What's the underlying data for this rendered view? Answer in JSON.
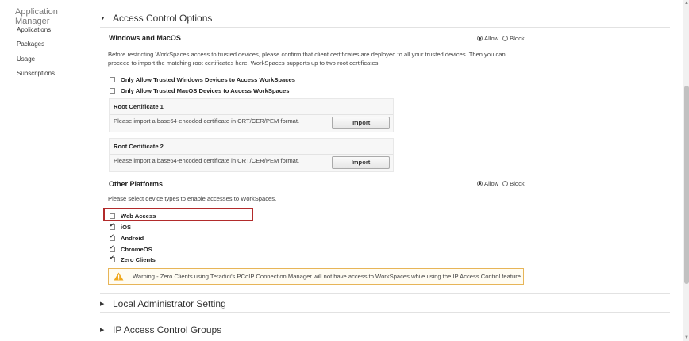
{
  "sidebar": {
    "title": "Application Manager",
    "items": [
      {
        "label": "Applications"
      },
      {
        "label": "Packages"
      },
      {
        "label": "Usage"
      },
      {
        "label": "Subscriptions"
      }
    ]
  },
  "access_control": {
    "title": "Access Control Options",
    "windows_macos": {
      "title": "Windows and MacOS",
      "allow_label": "Allow",
      "block_label": "Block",
      "selected": "Allow",
      "description_line1": "Before restricting WorkSpaces access to trusted devices, please confirm that client certificates are deployed to all your trusted devices. Then you can",
      "description_line2": "proceed to import the matching root certificates here. WorkSpaces supports up to two root certificates.",
      "options": [
        {
          "label": "Only Allow Trusted Windows Devices to Access WorkSpaces",
          "checked": false
        },
        {
          "label": "Only Allow Trusted MacOS Devices to Access WorkSpaces",
          "checked": false
        }
      ],
      "certificates": [
        {
          "title": "Root Certificate 1",
          "description": "Please import a base64-encoded certificate in CRT/CER/PEM format.",
          "button": "Import"
        },
        {
          "title": "Root Certificate 2",
          "description": "Please import a base64-encoded certificate in CRT/CER/PEM format.",
          "button": "Import"
        }
      ]
    },
    "other_platforms": {
      "title": "Other Platforms",
      "allow_label": "Allow",
      "block_label": "Block",
      "selected": "Allow",
      "description": "Please select device types to enable accesses to WorkSpaces.",
      "devices": [
        {
          "label": "Web Access",
          "checked": false
        },
        {
          "label": "iOS",
          "checked": true
        },
        {
          "label": "Android",
          "checked": true
        },
        {
          "label": "ChromeOS",
          "checked": true
        },
        {
          "label": "Zero Clients",
          "checked": true
        }
      ],
      "warning": "Warning - Zero Clients using Teradici's PCoIP Connection Manager will not have access to WorkSpaces while using the IP Access Control feature"
    }
  },
  "collapsed_sections": [
    {
      "title": "Local Administrator Setting"
    },
    {
      "title": "IP Access Control Groups"
    }
  ],
  "colors": {
    "highlight": "#b22b2b",
    "warning_border": "#e7b558",
    "warning_icon": "#f0a81c"
  }
}
